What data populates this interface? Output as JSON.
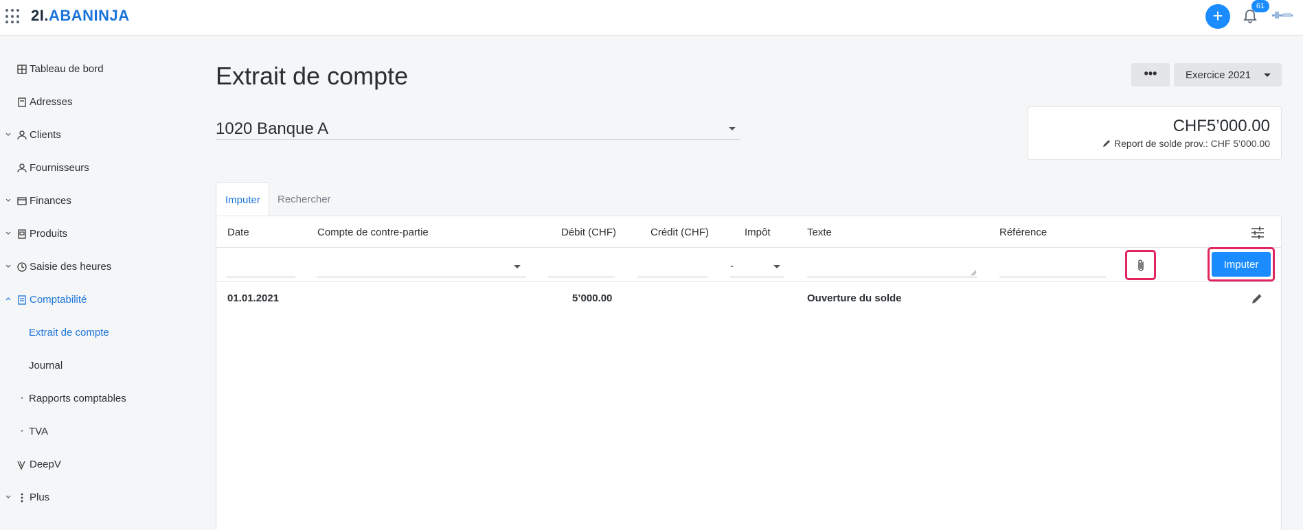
{
  "header": {
    "logo_prefix": "2I.",
    "logo_brand": "ABANINJA",
    "notification_count": "61",
    "icons": [
      "apps-grid-icon",
      "plus-icon",
      "bell-icon",
      "avatar-icon"
    ]
  },
  "sidebar": {
    "items": [
      {
        "label": "Tableau de bord",
        "icon": "dashboard-icon"
      },
      {
        "label": "Adresses",
        "icon": "address-book-icon"
      },
      {
        "label": "Clients",
        "icon": "clients-icon"
      },
      {
        "label": "Fournisseurs",
        "icon": "suppliers-icon"
      },
      {
        "label": "Finances",
        "icon": "finances-icon"
      },
      {
        "label": "Produits",
        "icon": "products-icon"
      },
      {
        "label": "Saisie des heures",
        "icon": "clock-icon"
      },
      {
        "label": "Comptabilité",
        "icon": "accounting-icon"
      },
      {
        "label": "Extrait de compte"
      },
      {
        "label": "Journal"
      },
      {
        "label": "Rapports comptables"
      },
      {
        "label": "TVA"
      },
      {
        "label": "DeepV",
        "icon": "deepv-icon"
      },
      {
        "label": "Plus",
        "icon": "more-vertical-icon"
      }
    ]
  },
  "page": {
    "title": "Extrait de compte",
    "more_label": "•••",
    "year_label": "Exercice 2021",
    "account": "1020 Banque A",
    "balance": "CHF5’000.00",
    "balance_report": "Report de solde prov.: CHF 5’000.00"
  },
  "tabs": [
    {
      "label": "Imputer",
      "active": true
    },
    {
      "label": "Rechercher",
      "active": false
    }
  ],
  "table": {
    "headers": [
      "Date",
      "Compte de contre-partie",
      "Débit (CHF)",
      "Crédit (CHF)",
      "Impôt",
      "Texte",
      "Référence"
    ],
    "entry_form": {
      "tax_value": "-",
      "submit_label": "Imputer"
    },
    "rows": [
      {
        "date": "01.01.2021",
        "debit": "5’000.00",
        "text": "Ouverture du solde"
      }
    ]
  },
  "colors": {
    "accent": "#1a8cff",
    "link_active": "#1a73d9",
    "highlight": "#e0245e"
  }
}
